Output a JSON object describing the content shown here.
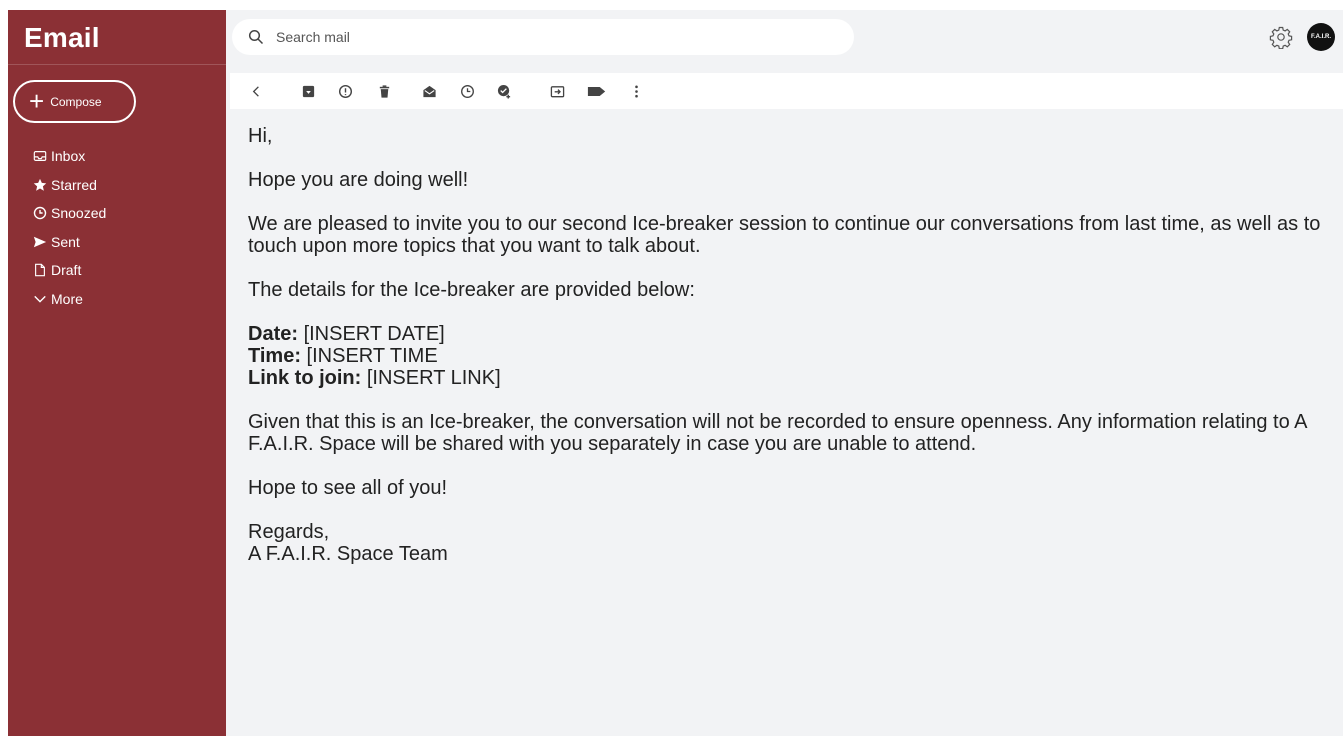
{
  "app": {
    "title": "Email"
  },
  "compose": {
    "label": "Compose"
  },
  "nav": [
    {
      "icon": "inbox-icon",
      "label": "Inbox"
    },
    {
      "icon": "star-icon",
      "label": "Starred"
    },
    {
      "icon": "clock-icon",
      "label": "Snoozed"
    },
    {
      "icon": "send-icon",
      "label": "Sent"
    },
    {
      "icon": "draft-icon",
      "label": "Draft"
    },
    {
      "icon": "chevron-down-icon",
      "label": "More"
    }
  ],
  "search": {
    "placeholder": "Search mail",
    "value": ""
  },
  "header": {
    "avatar_text": "F.A.I.R."
  },
  "toolbar": {
    "icons": [
      "back-icon",
      "archive-icon",
      "report-spam-icon",
      "delete-icon",
      "mark-unread-icon",
      "snooze-icon",
      "add-task-icon",
      "move-to-icon",
      "label-icon",
      "more-options-icon"
    ]
  },
  "email": {
    "greeting": "Hi,",
    "line1": "Hope you are doing well!",
    "para1": "We are pleased to invite you to our second Ice-breaker session to continue our conversations from last time, as well as to touch upon more topics that you want to talk about.",
    "para2": "The details for the Ice-breaker are provided below:",
    "date_label": "Date:",
    "date_value": " [INSERT DATE]",
    "time_label": "Time:",
    "time_value": " [INSERT TIME",
    "link_label": "Link to join:",
    "link_value": " [INSERT LINK]",
    "para3": "Given that this is an Ice-breaker, the conversation will not be recorded to ensure openness. Any information relating to A F.A.I.R. Space will be shared with you separately in case you are unable to attend.",
    "closing": "Hope to see all of you!",
    "signoff": "Regards,",
    "signature": "A F.A.I.R. Space Team"
  },
  "colors": {
    "sidebar": "#8b3035",
    "background": "#f2f3f5",
    "toolbar": "#ffffff"
  }
}
